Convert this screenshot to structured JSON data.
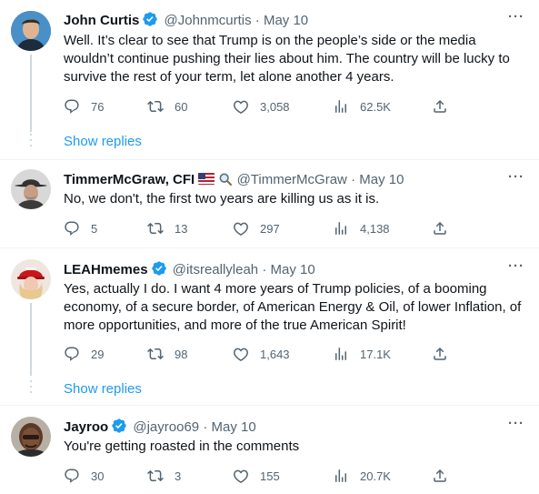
{
  "tweets": [
    {
      "name": "John Curtis",
      "handle": "@Johnmcurtis",
      "date": "· May 10",
      "text": "Well. It’s clear to see that Trump is on the people’s side or the media wouldn’t continue pushing their lies about him. The country will be lucky to survive the rest of your term, let alone another 4 years.",
      "replies": "76",
      "retweets": "60",
      "likes": "3,058",
      "views": "62.5K",
      "show_replies": "Show replies"
    },
    {
      "name": "TimmerMcGraw, CFI",
      "handle": "@TimmerMcGraw",
      "date": "· May 10",
      "text": "No, we don't, the first two years are killing us as it is.",
      "replies": "5",
      "retweets": "13",
      "likes": "297",
      "views": "4,138"
    },
    {
      "name": "LEAHmemes",
      "handle": "@itsreallyleah",
      "date": "· May 10",
      "text": "Yes, actually I do. I want 4 more years of Trump policies, of a booming economy, of a secure border, of American Energy & Oil, of lower Inflation, of more opportunities, and more of the true American Spirit!",
      "replies": "29",
      "retweets": "98",
      "likes": "1,643",
      "views": "17.1K",
      "show_replies": "Show replies"
    },
    {
      "name": "Jayroo",
      "handle": "@jayroo69",
      "date": "· May 10",
      "text": "You're getting roasted in the comments",
      "replies": "30",
      "retweets": "3",
      "likes": "155",
      "views": "20.7K"
    }
  ],
  "colors": {
    "accent": "#1d9bf0",
    "muted": "#536471",
    "text": "#0f1419"
  },
  "icons": [
    "verified-badge-icon",
    "us-flag-icon",
    "magnifier-icon",
    "reply-icon",
    "retweet-icon",
    "like-icon",
    "views-icon",
    "share-icon",
    "more-icon"
  ]
}
